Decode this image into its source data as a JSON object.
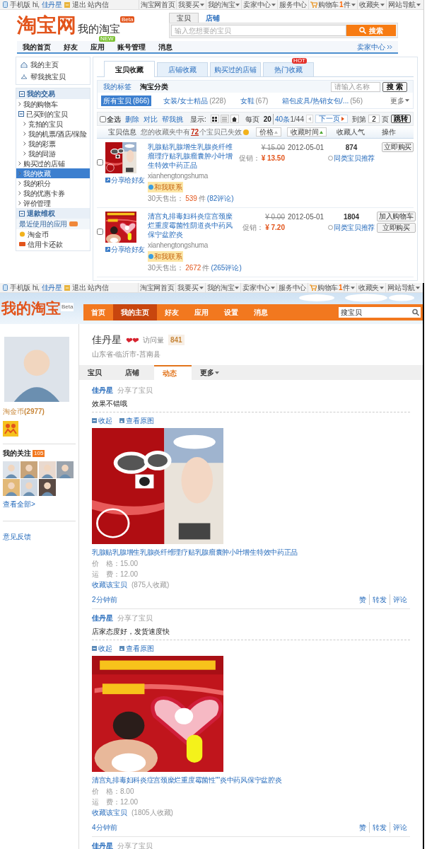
{
  "top_bar": {
    "mobile": "手机版",
    "greeting": "hi,",
    "user": "佳丹星",
    "logout": "退出",
    "messages": "站内信",
    "links": [
      {
        "label": "淘宝网首页",
        "dropdown": false
      },
      {
        "label": "我要买",
        "dropdown": true
      },
      {
        "label": "我的淘宝",
        "dropdown": true
      },
      {
        "label": "卖家中心",
        "dropdown": true
      },
      {
        "label": "服务中心",
        "dropdown": false
      },
      {
        "label": "购物车",
        "count": "1",
        "unit": "件",
        "dropdown": true
      },
      {
        "label": "收藏夹",
        "dropdown": true
      },
      {
        "label": "网站导航",
        "dropdown": true
      }
    ]
  },
  "header": {
    "logo": "淘宝网",
    "subtitle": "我的淘宝",
    "badge": "Beta",
    "search_tabs": [
      {
        "label": "宝贝",
        "selected": true
      },
      {
        "label": "店铺",
        "selected": false
      }
    ],
    "search_placeholder": "输入您想要的宝贝",
    "search_button": "搜索"
  },
  "nav": {
    "items": [
      {
        "label": "我的首页"
      },
      {
        "label": "好友"
      },
      {
        "label": "应用",
        "badge": "NEW"
      },
      {
        "label": "账号管理"
      },
      {
        "label": "消息"
      }
    ],
    "right_link": "卖家中心"
  },
  "sidebar": {
    "top_links": [
      {
        "label": "我的主页"
      },
      {
        "label": "帮我挑宝贝"
      }
    ],
    "sections": [
      {
        "title": "我的交易",
        "expanded": true,
        "items": [
          {
            "label": "我的购物车",
            "selected": false
          },
          {
            "label": "已买到的宝贝",
            "selected": false,
            "expanded": true,
            "children": [
              {
                "label": "竞拍的宝贝",
                "selected": false
              },
              {
                "label": "我的机票/酒店/保险",
                "selected": false
              },
              {
                "label": "我的彩票",
                "selected": false
              },
              {
                "label": "我的同游",
                "selected": false
              }
            ]
          },
          {
            "label": "购买过的店铺",
            "selected": false
          },
          {
            "label": "我的收藏",
            "selected": true
          },
          {
            "label": "我的积分",
            "selected": false
          },
          {
            "label": "我的优惠卡券",
            "selected": false
          },
          {
            "label": "评价管理",
            "selected": false
          }
        ]
      },
      {
        "title": "退款维权",
        "expanded": true
      }
    ],
    "apps": {
      "title": "最近使用的应用",
      "items": [
        {
          "label": "淘金币"
        },
        {
          "label": "信用卡还款"
        }
      ]
    }
  },
  "favorites": {
    "tabs": [
      {
        "label": "宝贝收藏",
        "selected": true
      },
      {
        "label": "店铺收藏",
        "selected": false
      },
      {
        "label": "购买过的店铺",
        "selected": false
      },
      {
        "label": "热门收藏",
        "selected": false,
        "badge": "HOT"
      }
    ],
    "subtabs": [
      {
        "label": "我的标签",
        "selected": false
      },
      {
        "label": "淘宝分类",
        "selected": true
      }
    ],
    "filter_placeholder": "请输入名称",
    "filter_button": "搜 索",
    "categories": [
      {
        "label": "所有宝贝",
        "count": "(866)",
        "selected": true
      },
      {
        "label": "女装/女士精品",
        "count": "(228)",
        "selected": false
      },
      {
        "label": "女鞋",
        "count": "(67)",
        "selected": false
      },
      {
        "label": "箱包皮具/热销女包/...",
        "count": "(56)",
        "selected": false
      }
    ],
    "more": "更多",
    "toolbar": {
      "select_all": "全选",
      "select_all_checked": false,
      "actions": [
        "删除",
        "对比",
        "帮我挑"
      ],
      "display_label": "显示:",
      "per_page_label": "每页",
      "per_page_options": [
        {
          "label": "20",
          "selected": true
        },
        {
          "label": "40条",
          "selected": false
        }
      ],
      "page_info": "1/44",
      "next": "下一页",
      "goto_label": "到第",
      "goto_value": "2",
      "goto_unit": "页",
      "goto_button": "跳转"
    },
    "columns": {
      "info": "宝贝信息",
      "notice_pre": "您的收藏夹中有",
      "notice_count": "72",
      "notice_post": "个宝贝已失效",
      "price": "价格",
      "time": "收藏时间",
      "popularity": "收藏人气",
      "action": "操作"
    },
    "rows": [
      {
        "checked": false,
        "title": "乳腺贴乳腺增生乳腺炎纤维瘤理疗贴乳腺瘤囊肿小叶增生特效中药正品",
        "seller": "xianhengtongshuma",
        "contact": "和我联系",
        "sold_label": "30天售出：",
        "sold": "539",
        "sold_unit": "件",
        "reviews": "(82评论)",
        "share": "分享给好友",
        "original_price": "¥ 15.00",
        "promo_label": "促销：",
        "promo_price": "¥ 13.50",
        "date": "2012-05-01",
        "popularity": "874",
        "similar": "同类宝贝推荐",
        "buttons": [
          "立即购买"
        ]
      },
      {
        "checked": false,
        "title": "清宫丸排毒妇科炎症宫颈糜烂重度霉菌性阴道炎中药风保宁盆腔炎",
        "seller": "xianhengtongshuma",
        "contact": "和我联系",
        "sold_label": "30天售出：",
        "sold": "2672",
        "sold_unit": "件",
        "reviews": "(265评论)",
        "share": "分享给好友",
        "original_price": "¥ 0.00",
        "promo_label": "促销：",
        "promo_price": "¥ 7.20",
        "date": "2012-05-01",
        "popularity": "1804",
        "similar": "同类宝贝推荐",
        "buttons": [
          "加入购物车",
          "立即购买"
        ]
      }
    ]
  },
  "top_bar_repeat": {
    "mobile": "手机版",
    "greeting": "hi,",
    "user": "佳丹星",
    "logout": "退出",
    "messages": "站内信",
    "links": [
      {
        "label": "淘宝网首页",
        "dropdown": false
      },
      {
        "label": "我要买",
        "dropdown": true
      },
      {
        "label": "我的淘宝",
        "dropdown": true
      },
      {
        "label": "卖家中心",
        "dropdown": true
      },
      {
        "label": "服务中心",
        "dropdown": false
      },
      {
        "label": "购物车",
        "count": "1",
        "unit": "件",
        "dropdown": true
      },
      {
        "label": "收藏夹",
        "dropdown": true
      },
      {
        "label": "网站导航",
        "dropdown": true
      }
    ]
  },
  "home": {
    "logo": "我的淘宝",
    "badge": "Beta",
    "nav": [
      {
        "label": "首页",
        "selected": false
      },
      {
        "label": "我的主页",
        "selected": true
      },
      {
        "label": "好友",
        "selected": false
      },
      {
        "label": "应用",
        "selected": false
      },
      {
        "label": "设置",
        "selected": false
      },
      {
        "label": "消息",
        "selected": false
      }
    ],
    "search_value": "搜宝贝"
  },
  "left": {
    "coins_label": "淘金币",
    "coins": "(2977)",
    "following_label": "我的关注",
    "following_count": "105",
    "view_all": "查看全部>",
    "feedback": "意见反馈"
  },
  "profile": {
    "name": "佳丹星",
    "visits_label": "访问量",
    "visits": "841",
    "location": "山东省-临沂市-莒南县",
    "tabs": [
      {
        "label": "宝贝",
        "selected": false,
        "dropdown": false
      },
      {
        "label": "店铺",
        "selected": false,
        "dropdown": false
      },
      {
        "label": "动态",
        "selected": true,
        "dropdown": false
      },
      {
        "label": "更多",
        "selected": false,
        "dropdown": true
      }
    ]
  },
  "feed": [
    {
      "user": "佳丹星",
      "action": "分享了宝贝",
      "comment": "效果不错哦",
      "collapse": "收起",
      "view_original": "查看原图",
      "title": "乳腺贴乳腺增生乳腺炎纤维理疗贴乳腺瘤囊肿小叶增生特效中药正品",
      "price": "价　格：15.00",
      "shipping": "运　费：12.00",
      "favorite": "收藏该宝贝",
      "favorite_count": "(875人收藏)",
      "time": "2分钟前",
      "actions": [
        "赞",
        "转发",
        "评论"
      ]
    },
    {
      "user": "佳丹星",
      "action": "分享了宝贝",
      "comment": "店家态度好，发货速度快",
      "collapse": "收起",
      "view_original": "查看原图",
      "title": "清宫丸排毒妇科炎症宫颈糜烂重度霉菌性\"\"炎中药风保宁盆腔炎",
      "price": "价　格：8.00",
      "shipping": "运　费：12.00",
      "favorite": "收藏该宝贝",
      "favorite_count": "(1805人收藏)",
      "time": "4分钟前",
      "actions": [
        "赞",
        "转发",
        "评论"
      ]
    },
    {
      "user": "佳丹星",
      "action": "分享了宝贝"
    }
  ]
}
